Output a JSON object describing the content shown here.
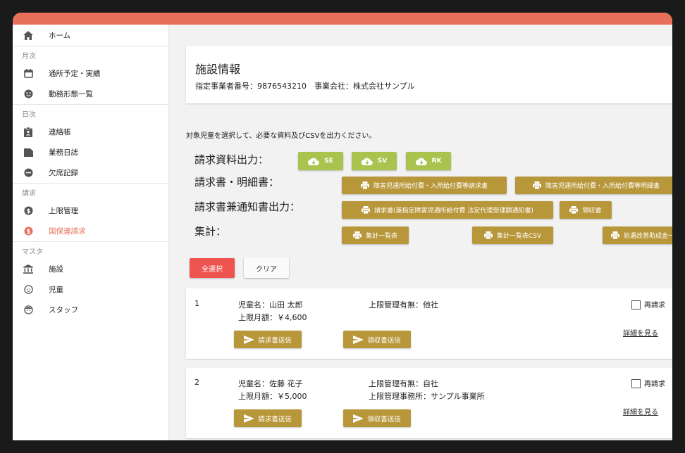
{
  "sidebar": {
    "home": "ホーム",
    "sections": {
      "monthly": "月次",
      "daily": "日次",
      "billing": "請求",
      "master": "マスタ"
    },
    "items": {
      "schedule": "通所予定・実績",
      "shift": "勤務形態一覧",
      "contact": "連絡帳",
      "diary": "業務日誌",
      "absence": "欠席記録",
      "upper_limit": "上限管理",
      "kokuho": "国保連請求",
      "facility": "施設",
      "child": "児童",
      "staff": "スタッフ"
    },
    "active": "kokuho",
    "active_color": "#e8705a"
  },
  "facility": {
    "title": "施設情報",
    "sub": "指定事業者番号：9876543210　事業会社：株式会社サンプル"
  },
  "instruction": "対象児童を選択して、必要な資料及びCSVを出力ください。",
  "rows": {
    "seikyu_shiryo": "請求資料出力：",
    "seikyusho": "請求書・明細書：",
    "kentsuchi": "請求書兼通知書出力：",
    "shukei": "集計："
  },
  "buttons": {
    "se": "SE",
    "sv": "SV",
    "rk": "RK",
    "seikyusho_btn": "障害児通所給付費・入所給付費等請求書",
    "meisaisho_btn": "障害児通所給付費・入所給付費等明細書",
    "kentsuchi_btn": "請求書(兼指定障害児通所給付費 法定代理受理額通知書)",
    "ryoshu_btn": "領収書",
    "shukei_btn": "集計一覧表",
    "shukei_csv_btn": "集計一覧表CSV",
    "shogu_btn": "処遇改善助成金一覧",
    "select_all": "全選択",
    "clear": "クリア"
  },
  "colors": {
    "topbar": "#e8705a",
    "green": "#a9c34f",
    "gold": "#b8973a",
    "select_all": "#ef5350"
  },
  "children": [
    {
      "index": "1",
      "name": "児童名：山田 太郎",
      "limit_amount": "上限月額：￥4,600",
      "limit_mgmt": "上限管理有無：他社",
      "limit_office": "",
      "rebill": "再請求",
      "send_invoice": "請求書送信",
      "send_receipt": "領収書送信",
      "details": "詳細を見る"
    },
    {
      "index": "2",
      "name": "児童名：佐藤 花子",
      "limit_amount": "上限月額：￥5,000",
      "limit_mgmt": "上限管理有無：自社",
      "limit_office": "上限管理事務所：サンプル事業所",
      "rebill": "再請求",
      "send_invoice": "請求書送信",
      "send_receipt": "領収書送信",
      "details": "詳細を見る"
    }
  ]
}
